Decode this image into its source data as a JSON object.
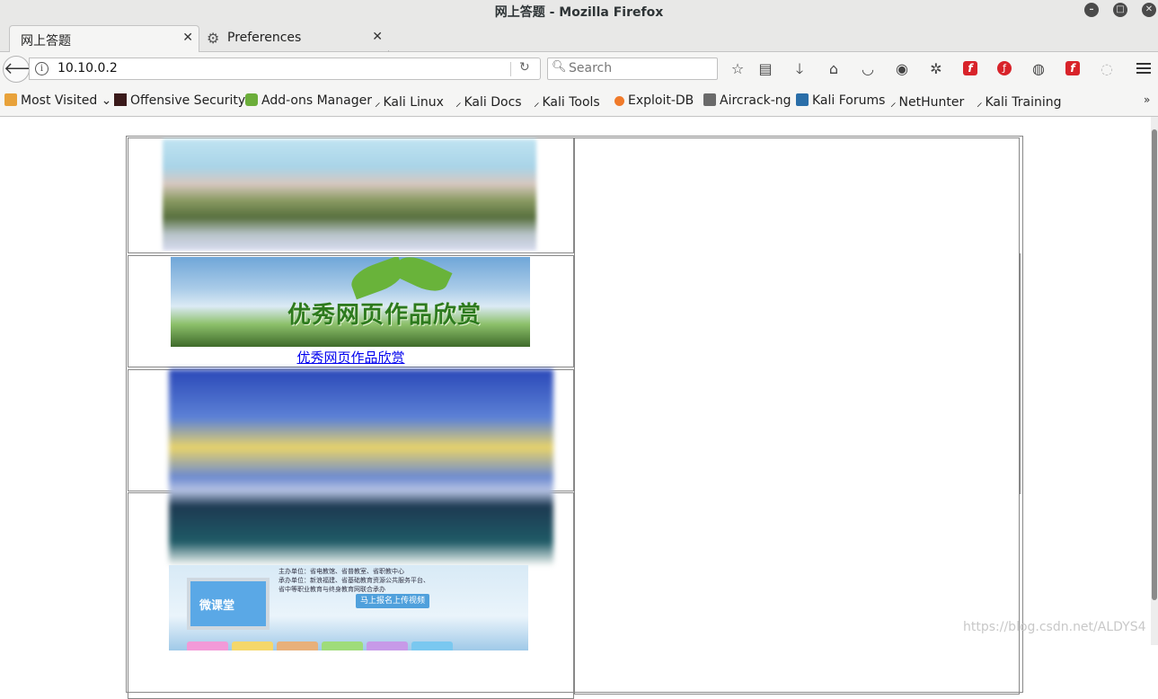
{
  "window": {
    "title": "网上答题 - Mozilla Firefox"
  },
  "tabs": [
    {
      "label": "网上答题",
      "active": true
    },
    {
      "label": "Preferences",
      "active": false
    }
  ],
  "navbar": {
    "url": "10.10.0.2",
    "search_placeholder": "Search"
  },
  "bookmarks": [
    {
      "label": "Most Visited",
      "icon": "folder-icon"
    },
    {
      "label": "Offensive Security",
      "icon": "offsec-icon"
    },
    {
      "label": "Add-ons Manager",
      "icon": "puzzle-icon"
    },
    {
      "label": "Kali Linux",
      "icon": "kali-dragon-icon"
    },
    {
      "label": "Kali Docs",
      "icon": "kali-dragon-icon"
    },
    {
      "label": "Kali Tools",
      "icon": "kali-dragon-icon"
    },
    {
      "label": "Exploit-DB",
      "icon": "exploitdb-icon"
    },
    {
      "label": "Aircrack-ng",
      "icon": "aircrack-icon"
    },
    {
      "label": "Kali Forums",
      "icon": "kali-forums-icon"
    },
    {
      "label": "NetHunter",
      "icon": "kali-dragon-icon"
    },
    {
      "label": "Kali Training",
      "icon": "kali-dragon-icon"
    }
  ],
  "page": {
    "banner_text": "优秀网页作品欣赏",
    "banner_link": "优秀网页作品欣赏",
    "weiketang_label": "微课堂",
    "upload_button": "马上报名上传视频",
    "info_lines": [
      "主办单位：省电教馆、省普教室、省职教中心",
      "承办单位：新浪福建、省基础教育资源公共服务平台、",
      "省中等职业教育与终身教育网联合承办"
    ]
  },
  "watermark": "https://blog.csdn.net/ALDYS4"
}
